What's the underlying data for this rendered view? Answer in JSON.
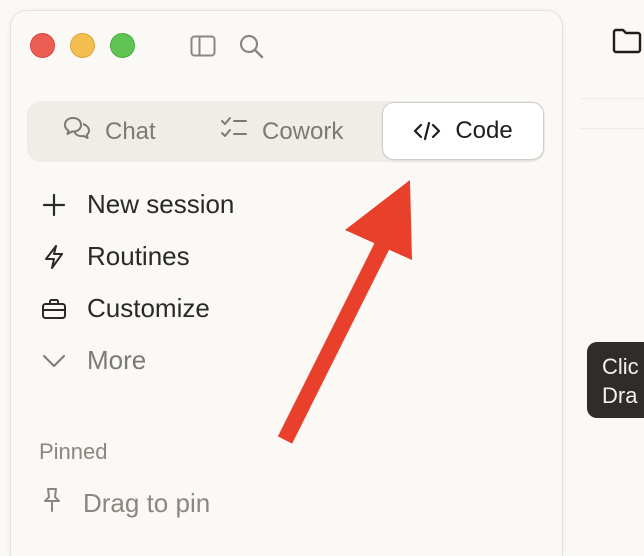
{
  "window": {
    "controls": [
      "close",
      "minimize",
      "zoom"
    ],
    "toolbar_icons": [
      "sidebar-toggle-icon",
      "search-icon"
    ]
  },
  "mode_switcher": {
    "tabs": [
      {
        "label": "Chat",
        "icon": "chat-bubbles-icon",
        "selected": false
      },
      {
        "label": "Cowork",
        "icon": "checklist-icon",
        "selected": false
      },
      {
        "label": "Code",
        "icon": "code-brackets-icon",
        "selected": true
      }
    ]
  },
  "nav": {
    "items": [
      {
        "label": "New session",
        "icon": "plus-icon"
      },
      {
        "label": "Routines",
        "icon": "lightning-icon"
      },
      {
        "label": "Customize",
        "icon": "briefcase-icon"
      },
      {
        "label": "More",
        "icon": "chevron-down-icon"
      }
    ]
  },
  "pinned": {
    "section_label": "Pinned",
    "placeholder": "Drag to pin",
    "icon": "pin-icon"
  },
  "right_panel": {
    "icon": "folder-icon",
    "tooltip_lines": [
      "Clic",
      "Dra"
    ]
  },
  "annotation": {
    "type": "arrow",
    "color": "#e8402b",
    "points_to": "Code tab"
  },
  "colors": {
    "background": "#faf9f5",
    "selected_tab": "#ffffff",
    "segment_track": "#efede7",
    "tooltip_bg": "#2e2d2a",
    "close": "#ec5d54",
    "minimize": "#f4bd4f",
    "zoom": "#5fc453"
  }
}
